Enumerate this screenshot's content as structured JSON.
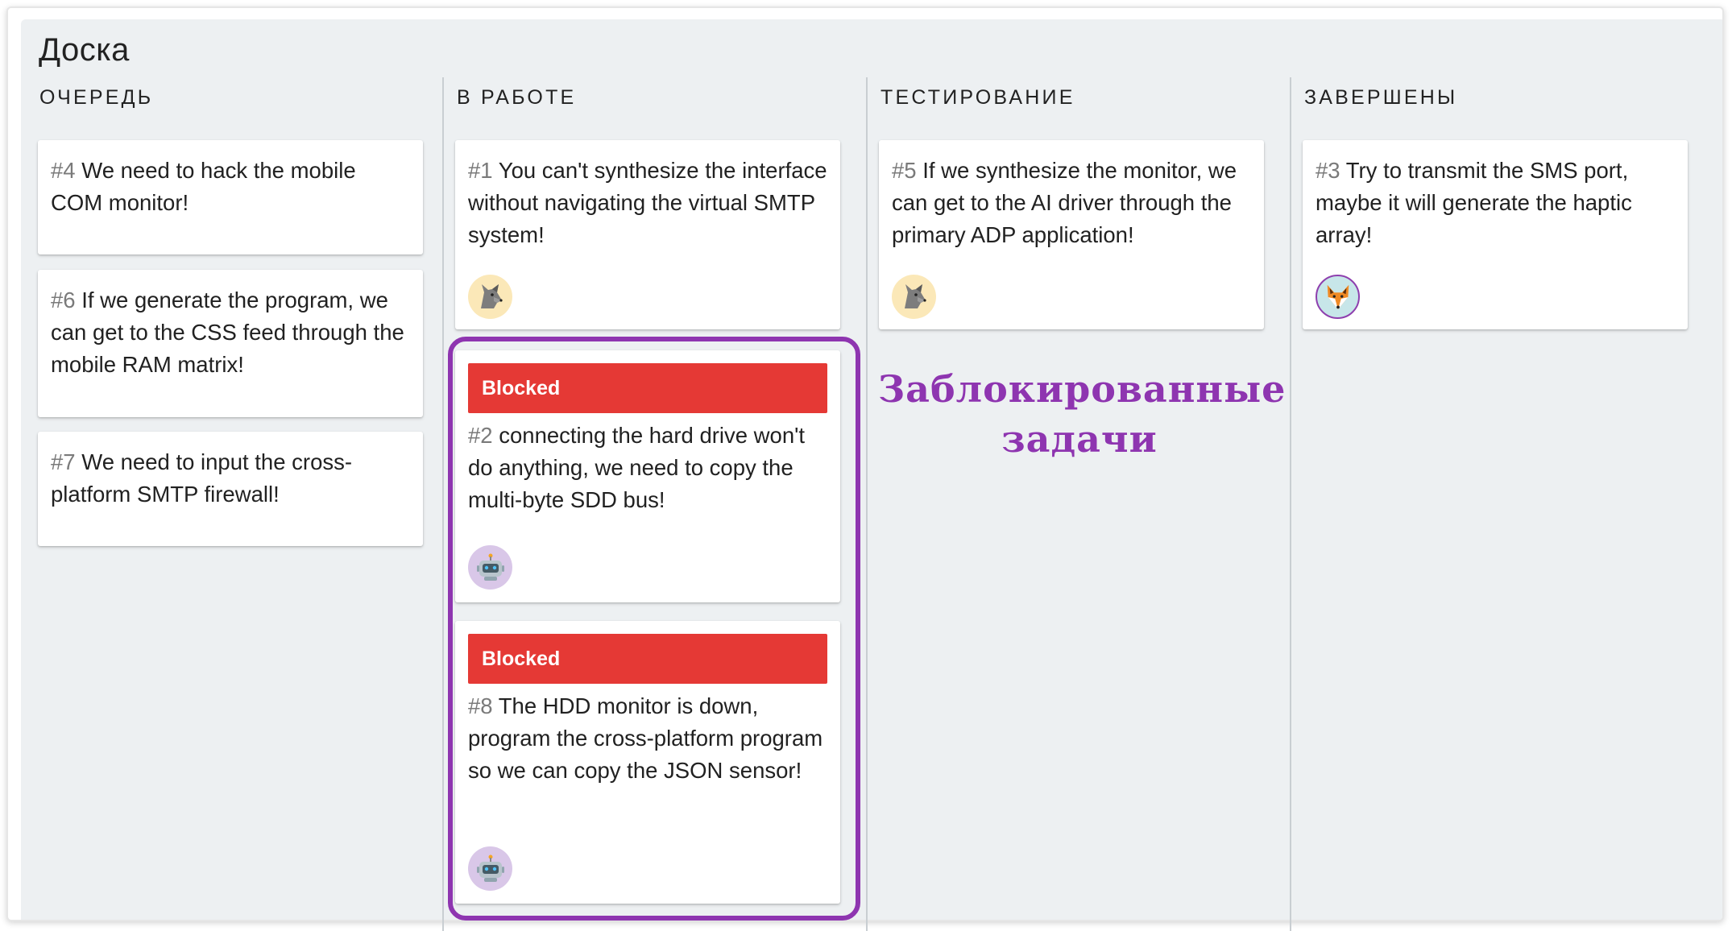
{
  "board": {
    "title": "Доска"
  },
  "columns": [
    {
      "title": "ОЧЕРЕДЬ",
      "cards": [
        {
          "id": "#4",
          "text": "We need to hack the mobile COM monitor!"
        },
        {
          "id": "#6",
          "text": "If we generate the program, we can get to the CSS feed through the mobile RAM matrix!"
        },
        {
          "id": "#7",
          "text": "We need to input the cross-platform SMTP firewall!"
        }
      ]
    },
    {
      "title": "В РАБОТЕ",
      "cards": [
        {
          "id": "#1",
          "text": "You can't synthesize the interface without navigating the virtual SMTP system!",
          "avatar": "wolf-icon"
        },
        {
          "id": "#2",
          "text": "connecting the hard drive won't do anything, we need to copy the multi-byte SDD bus!",
          "status": "Blocked",
          "avatar": "robot-icon"
        },
        {
          "id": "#8",
          "text": "The HDD monitor is down, program the cross-platform program so we can copy the JSON sensor!",
          "status": "Blocked",
          "avatar": "robot-icon"
        }
      ]
    },
    {
      "title": "ТЕСТИРОВАНИЕ",
      "cards": [
        {
          "id": "#5",
          "text": "If we synthesize the monitor, we can get to the AI driver through the primary ADP application!",
          "avatar": "wolf-icon"
        }
      ]
    },
    {
      "title": "ЗАВЕРШЕНЫ",
      "cards": [
        {
          "id": "#3",
          "text": "Try to transmit the SMS port, maybe it will generate the haptic array!",
          "avatar": "fox-icon"
        }
      ]
    }
  ],
  "annotation": {
    "line1": "Заблокированные",
    "line2": "задачи"
  },
  "colors": {
    "blocked": "#e53935",
    "highlight": "#8e35b0",
    "board_bg": "#edf0f2"
  }
}
